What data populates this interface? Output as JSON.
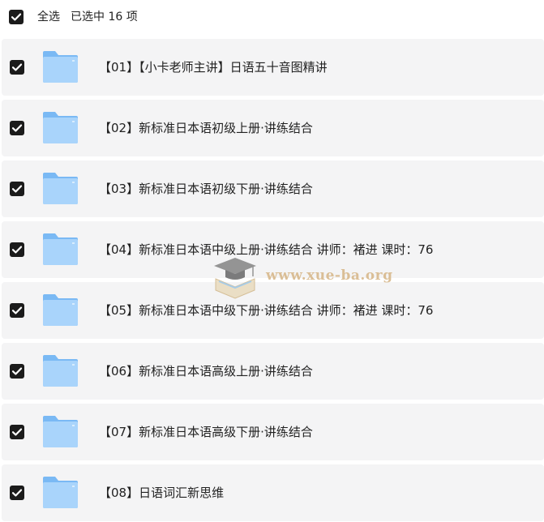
{
  "header": {
    "select_all_label": "全选",
    "selected_text": "已选中  16  项",
    "checked": true
  },
  "rows": [
    {
      "name": "【01】【小卡老师主讲】日语五十音图精讲",
      "checked": true,
      "icon": "folder-icon"
    },
    {
      "name": "【02】新标准日本语初级上册·讲练结合",
      "checked": true,
      "icon": "folder-icon"
    },
    {
      "name": "【03】新标准日本语初级下册·讲练结合",
      "checked": true,
      "icon": "folder-icon"
    },
    {
      "name": "【04】新标准日本语中级上册·讲练结合 讲师：褚进 课时：76",
      "checked": true,
      "icon": "folder-icon"
    },
    {
      "name": "【05】新标准日本语中级下册·讲练结合 讲师：褚进 课时：76",
      "checked": true,
      "icon": "folder-icon"
    },
    {
      "name": "【06】新标准日本语高级上册·讲练结合",
      "checked": true,
      "icon": "folder-icon"
    },
    {
      "name": "【07】新标准日本语高级下册·讲练结合",
      "checked": true,
      "icon": "folder-icon"
    },
    {
      "name": "【08】日语词汇新思维",
      "checked": true,
      "icon": "folder-icon"
    }
  ],
  "watermark": {
    "text": "www.xue-ba.org"
  },
  "colors": {
    "row_background": "#f4f4f5",
    "checkbox": "#1b1b1b",
    "folder_light": "#a9d4fb",
    "folder_dark": "#7ab9f4",
    "watermark": "#d8b98c"
  }
}
